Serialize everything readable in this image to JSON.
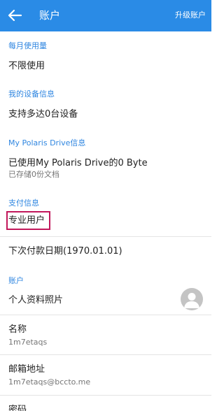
{
  "appbar": {
    "title": "账户",
    "upgrade_label": "升级账户"
  },
  "sections": {
    "monthly_usage": {
      "header": "每月使用量",
      "value": "不限使用"
    },
    "device_info": {
      "header": "我的设备信息",
      "value": "支持多达0台设备"
    },
    "drive_info": {
      "header": "My Polaris Drive信息",
      "value": "已使用My Polaris Drive的0 Byte",
      "sub": "已存储0份文档"
    },
    "payment_info": {
      "header": "支付信息",
      "plan": "专业用户",
      "next_payment": "下次付款日期(1970.01.01)"
    },
    "account": {
      "header": "账户",
      "profile_photo_label": "个人资料照片",
      "name_label": "名称",
      "name_value": "1m7etaqs",
      "email_label": "邮箱地址",
      "email_value": "1m7etaqs@bccto.me",
      "password_label": "密码"
    }
  },
  "colors": {
    "appbar": "#2a8be6",
    "section_header": "#2f86e0",
    "highlight_border": "#c2185b"
  },
  "icons": {
    "back": "arrow-left-icon",
    "avatar": "person-placeholder-icon"
  }
}
